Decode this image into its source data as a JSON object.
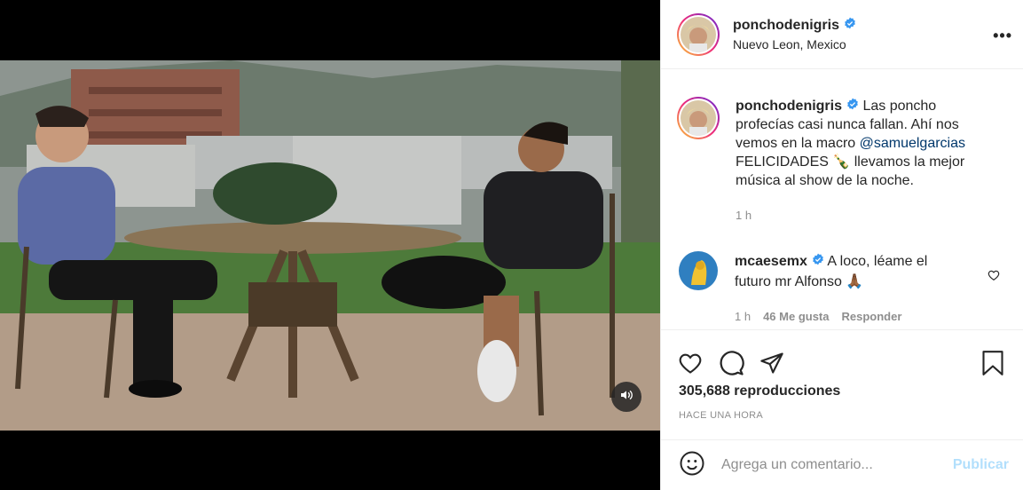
{
  "post": {
    "author": "ponchodenigris",
    "location": "Nuevo Leon, Mexico",
    "more_icon": "more-horizontal-icon",
    "accent": "#0095f6"
  },
  "caption": {
    "author": "ponchodenigris",
    "text_part1": "Las poncho profecías casi nunca fallan. Ahí nos vemos en la macro ",
    "mention": "@samuelgarcias",
    "text_part2": " FELICIDADES 🍾 llevamos la mejor música al show de la noche.",
    "time": "1 h"
  },
  "comment": {
    "author": "mcaesemx",
    "text": "A loco, léame el futuro mr Alfonso 🙏🏾",
    "time": "1 h",
    "likes": "46 Me gusta",
    "reply": "Responder"
  },
  "actions": {
    "views": "305,688 reproducciones",
    "time_ago": "HACE UNA HORA"
  },
  "add_comment": {
    "placeholder": "Agrega un comentario...",
    "publish": "Publicar"
  }
}
